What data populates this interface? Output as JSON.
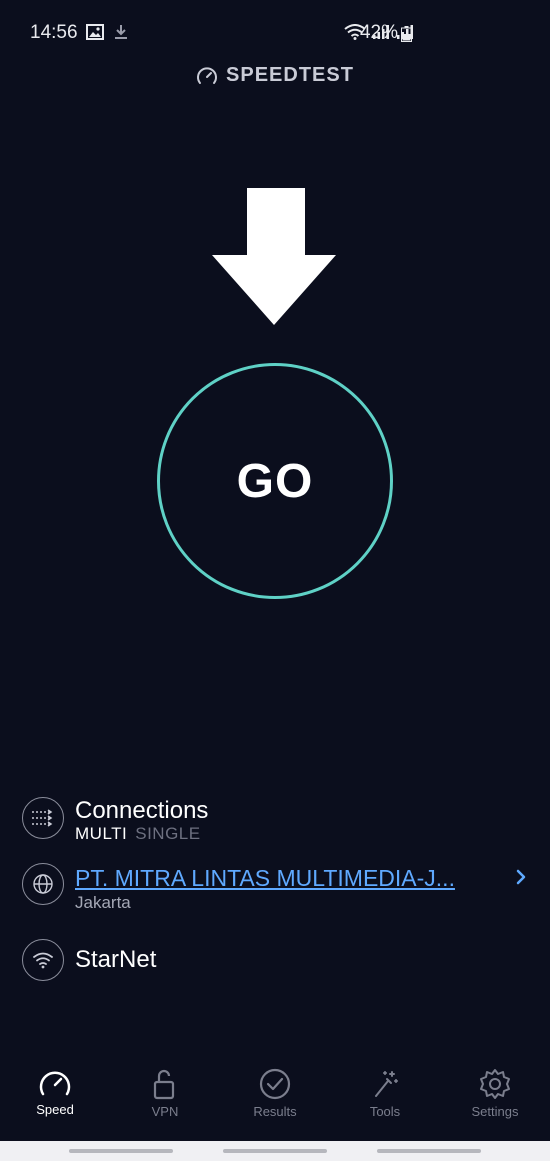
{
  "status_bar": {
    "time": "14:56",
    "battery": "42%"
  },
  "app": {
    "title": "SPEEDTEST"
  },
  "go_button": {
    "label": "GO"
  },
  "connections": {
    "title": "Connections",
    "option_multi": "MULTI",
    "option_single": "SINGLE"
  },
  "server": {
    "name": "PT. MITRA LINTAS MULTIMEDIA-J...",
    "city": "Jakarta"
  },
  "network": {
    "name": "StarNet"
  },
  "nav": {
    "items": [
      {
        "label": "Speed",
        "icon": "speedometer-icon",
        "active": true
      },
      {
        "label": "VPN",
        "icon": "unlock-icon",
        "active": false
      },
      {
        "label": "Results",
        "icon": "check-circle-icon",
        "active": false
      },
      {
        "label": "Tools",
        "icon": "magic-wand-icon",
        "active": false
      },
      {
        "label": "Settings",
        "icon": "gear-icon",
        "active": false
      }
    ]
  },
  "colors": {
    "background": "#0b0e1d",
    "accent_ring": "#5fd1c6",
    "link_blue": "#5fa9ff"
  }
}
